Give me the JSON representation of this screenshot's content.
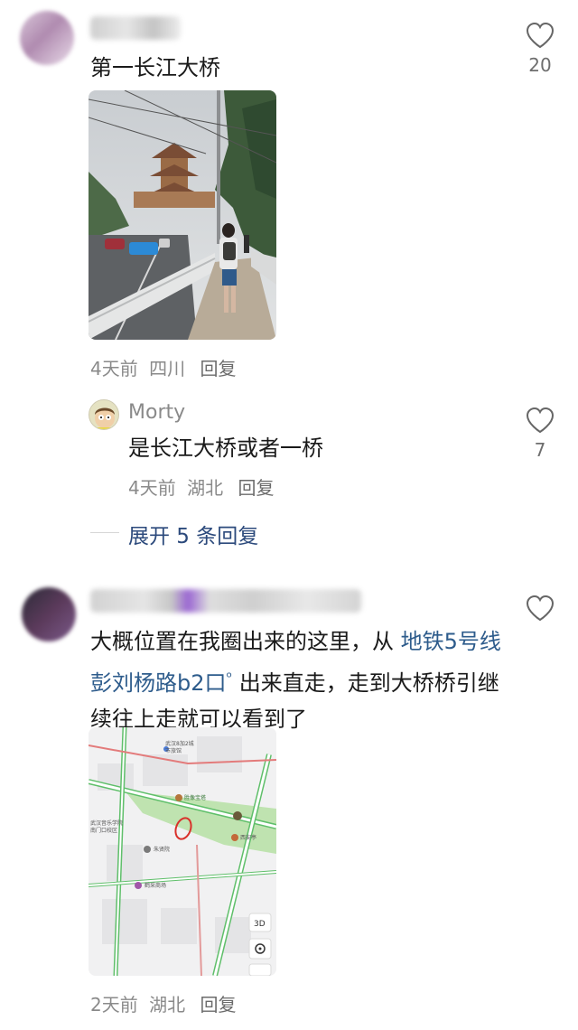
{
  "comment1": {
    "text": "第一长江大桥",
    "meta_time": "4天前",
    "meta_location": "四川",
    "reply_label": "回复",
    "like_count": "20"
  },
  "reply1": {
    "username": "Morty",
    "text": "是长江大桥或者一桥",
    "meta_time": "4天前",
    "meta_location": "湖北",
    "reply_label": "回复",
    "like_count": "7"
  },
  "expand_label": "展开 5 条回复",
  "comment2": {
    "text_before": "大概位置在我圈出来的这里，从 ",
    "link_text": "地铁5号线彭刘杨路b2口",
    "text_after": " 出来直走，走到大桥桥引继续往上走就可以看到了",
    "meta_time": "2天前",
    "meta_location": "湖北",
    "reply_label": "回复"
  },
  "map": {
    "labels": [
      "武汉8加2城市旅馆",
      "胜像宝塔",
      "西安亭",
      "武汉音乐学院南门口校区",
      "朱贤院",
      "鹤采商场",
      "武昌路",
      "彭刘杨路"
    ],
    "btn_3d": "3D"
  },
  "colors": {
    "link": "#2e5c8c",
    "meta": "#8a8a8a",
    "expand": "#2c4a7c"
  }
}
